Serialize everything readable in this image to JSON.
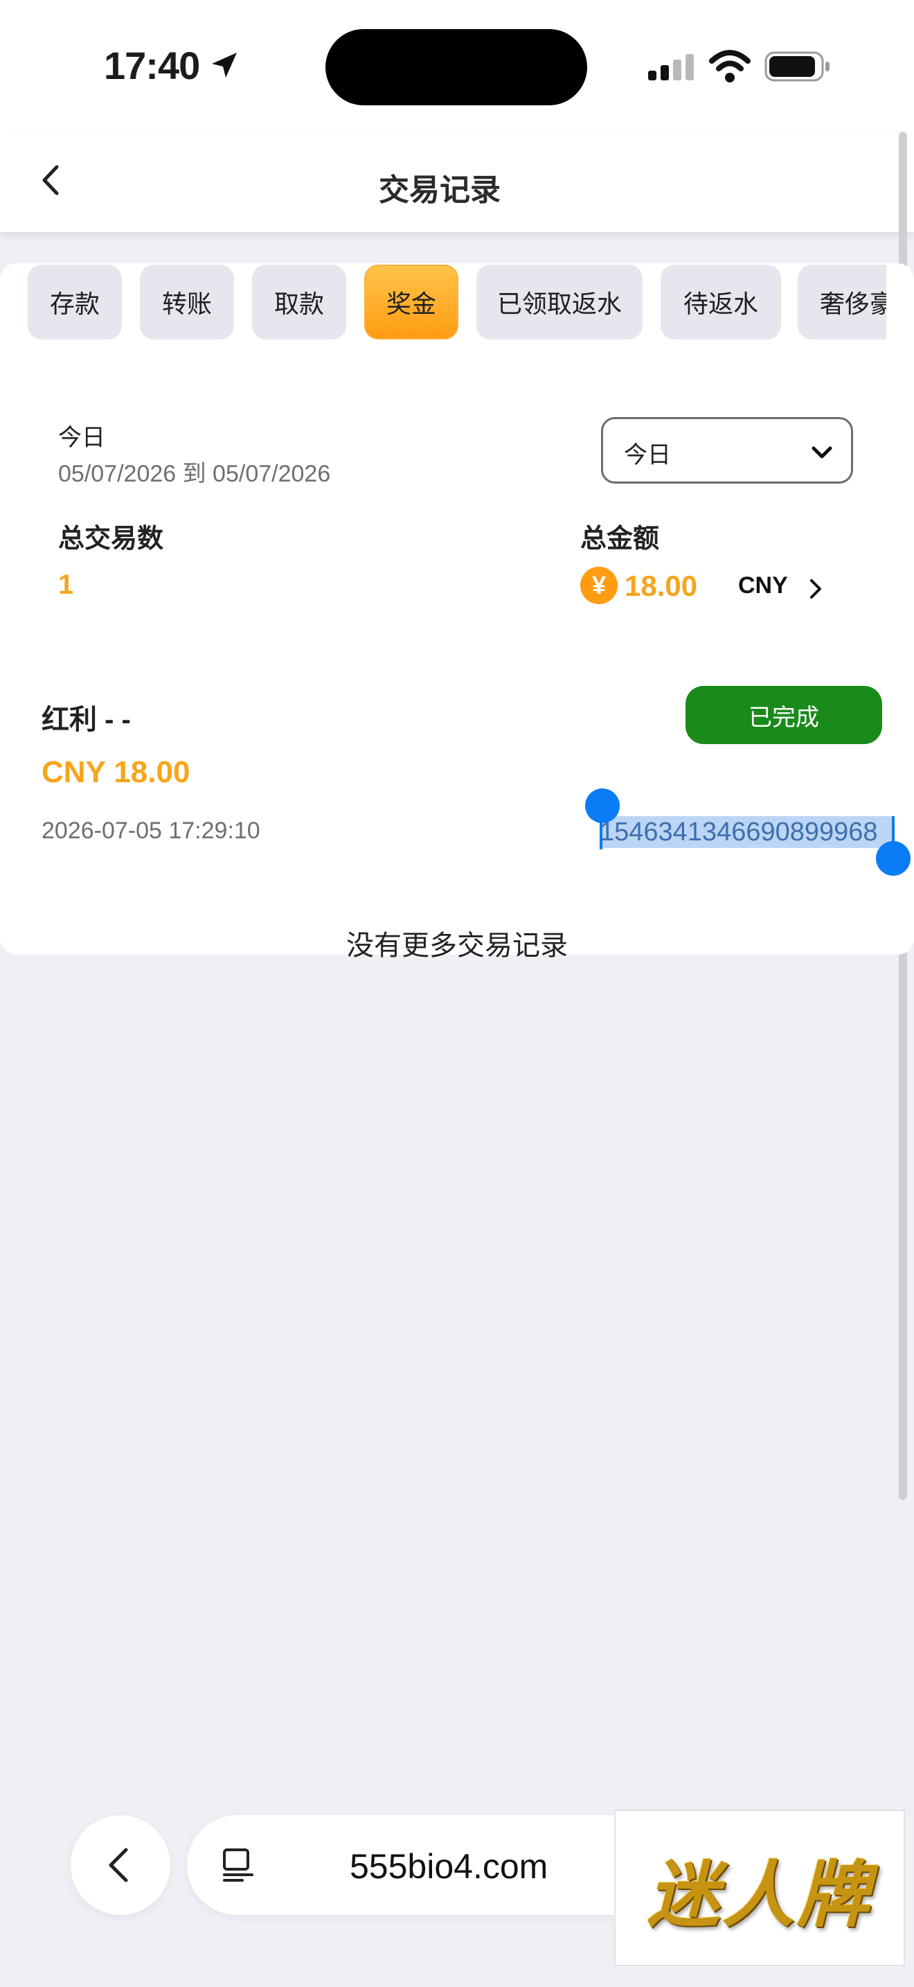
{
  "status_bar": {
    "time": "17:40"
  },
  "header": {
    "title": "交易记录"
  },
  "tabs": [
    {
      "label": "存款",
      "active": false
    },
    {
      "label": "转账",
      "active": false
    },
    {
      "label": "取款",
      "active": false
    },
    {
      "label": "奖金",
      "active": true
    },
    {
      "label": "已领取返水",
      "active": false
    },
    {
      "label": "待返水",
      "active": false
    },
    {
      "label": "奢侈豪",
      "active": false
    }
  ],
  "summary": {
    "period_label": "今日",
    "date_range": "05/07/2026 到 05/07/2026",
    "date_filter_value": "今日",
    "total_count_label": "总交易数",
    "total_count": "1",
    "total_amount_label": "总金额",
    "total_amount": "18.00",
    "currency_symbol": "¥",
    "currency": "CNY"
  },
  "transactions": [
    {
      "type": "红利 - -",
      "amount": "CNY 18.00",
      "datetime": "2026-07-05 17:29:10",
      "status": "已完成",
      "id": "1546341346690899968"
    }
  ],
  "list_end_text": "没有更多交易记录",
  "browser": {
    "url": "555bio4.com"
  },
  "overlay_logo": "迷人牌",
  "colors": {
    "accent": "#ffa51f",
    "amount": "#f6a51c",
    "success": "#1a8a1a",
    "selection": "#0a7cf5"
  }
}
